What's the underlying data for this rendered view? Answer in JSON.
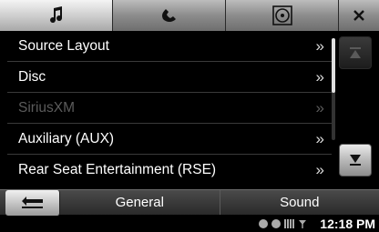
{
  "tabs": [
    {
      "icon": "music-note-icon",
      "active": true
    },
    {
      "icon": "phone-icon",
      "active": false
    },
    {
      "icon": "disc-icon",
      "active": false
    },
    {
      "icon": "close-icon",
      "active": false
    }
  ],
  "list": {
    "items": [
      {
        "label": "Source Layout",
        "chevron": "»",
        "enabled": true
      },
      {
        "label": "Disc",
        "chevron": "»",
        "enabled": true
      },
      {
        "label": "SiriusXM",
        "chevron": "»",
        "enabled": false
      },
      {
        "label": "Auxiliary (AUX)",
        "chevron": "»",
        "enabled": true
      },
      {
        "label": "Rear Seat Entertainment (RSE)",
        "chevron": "»",
        "enabled": true
      }
    ]
  },
  "scroll": {
    "up_icon": "scroll-up-icon",
    "down_icon": "scroll-down-icon",
    "position": 0.0
  },
  "bottom": {
    "back_icon": "back-arrow-icon",
    "general": "General",
    "sound": "Sound"
  },
  "status": {
    "time": "12:18 PM",
    "icons": [
      "status-icon-1",
      "status-icon-2",
      "battery-icon",
      "signal-icon"
    ]
  }
}
